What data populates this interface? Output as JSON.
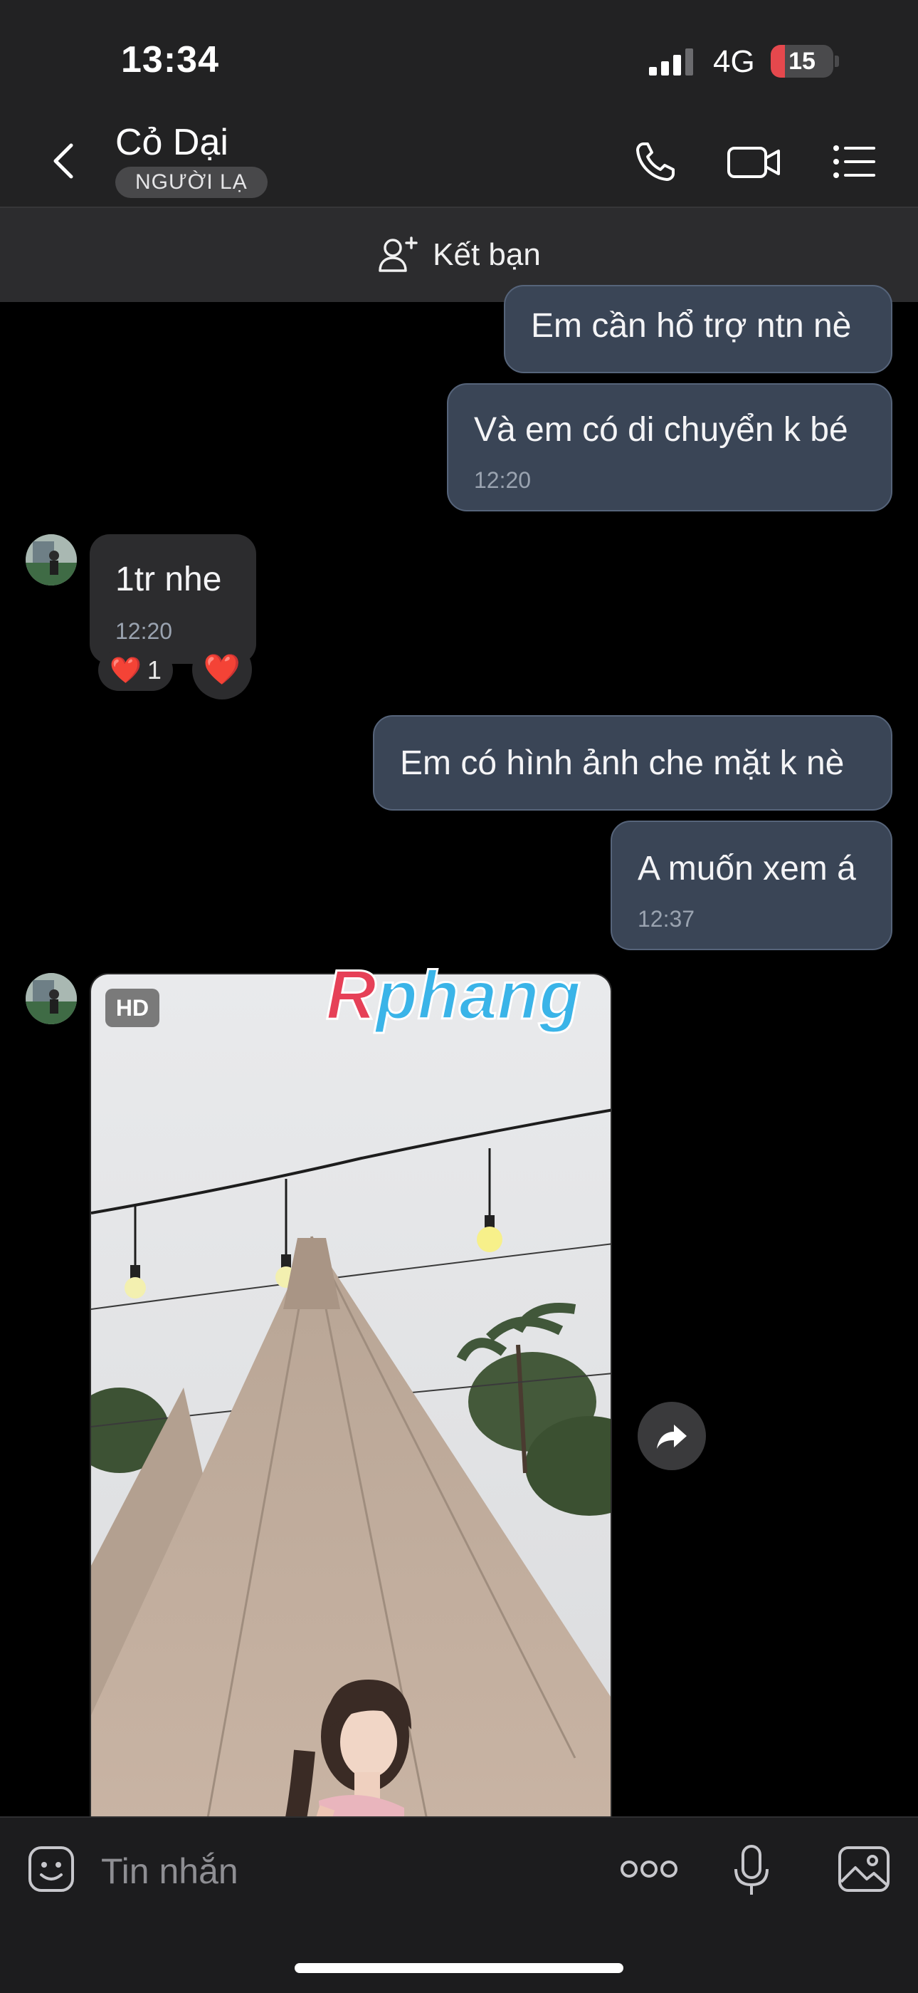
{
  "status_bar": {
    "time": "13:34",
    "network": "4G",
    "battery": "15",
    "battery_color": "#e5484d"
  },
  "header": {
    "contact_name": "Cỏ Dại",
    "badge": "NGƯỜI LẠ",
    "icons": [
      "back-chevron-icon",
      "phone-icon",
      "video-call-icon",
      "menu-list-icon"
    ]
  },
  "friend_bar": {
    "label": "Kết bạn",
    "icon": "add-friend-icon"
  },
  "messages": [
    {
      "direction": "out",
      "text": "Em cần hổ trợ ntn nè"
    },
    {
      "direction": "out",
      "text": "Và em có di chuyển k bé",
      "time": "12:20"
    },
    {
      "direction": "in",
      "text": "1tr nhe",
      "time": "12:20",
      "reaction": {
        "emoji": "❤️",
        "count": "1"
      }
    },
    {
      "direction": "out",
      "text": "Em có hình ảnh che mặt k nè"
    },
    {
      "direction": "out",
      "text": "A muốn xem á",
      "time": "12:37"
    }
  ],
  "photo_message": {
    "badge": "HD",
    "watermark": "Rphang"
  },
  "input_bar": {
    "placeholder": "Tin nhắn"
  },
  "colors": {
    "outgoing_bubble": "#3a4556",
    "incoming_bubble": "#2c2c2e",
    "header_bg": "#222223"
  }
}
